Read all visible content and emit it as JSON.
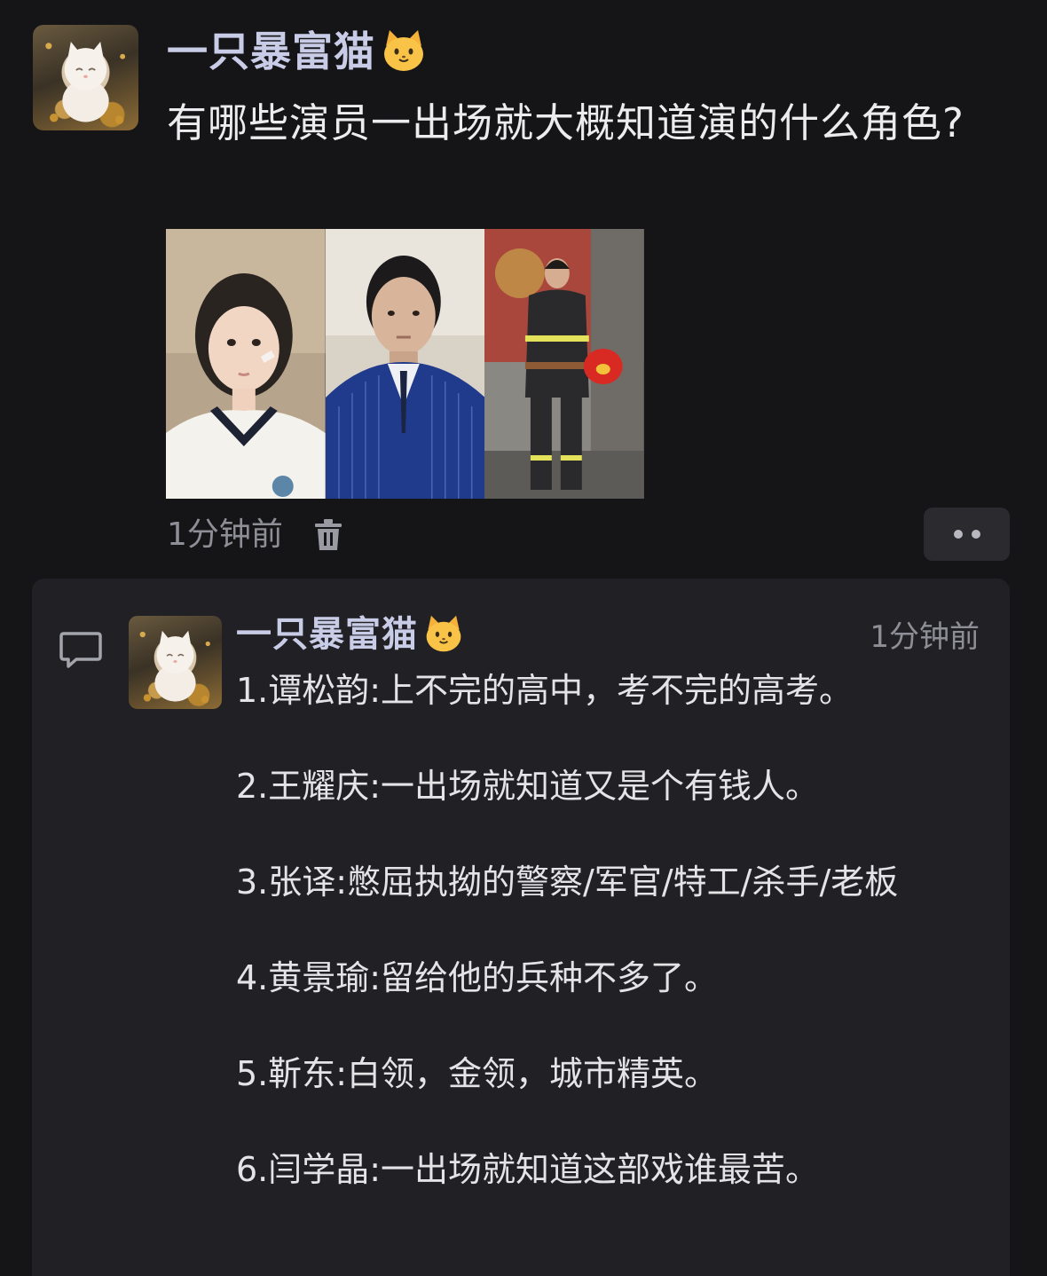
{
  "post": {
    "author": "一只暴富猫",
    "author_emoji": "cat-face-emoji",
    "question": "有哪些演员一出场就大概知道演的什么角色?",
    "time": "1分钟前",
    "photos": [
      {
        "name": "photo-girl-school-uniform"
      },
      {
        "name": "photo-man-pinstripe-suit"
      },
      {
        "name": "photo-firefighter"
      }
    ]
  },
  "comment": {
    "author": "一只暴富猫",
    "time": "1分钟前",
    "lines": [
      "1.谭松韵:上不完的高中，考不完的高考。",
      "2.王耀庆:一出场就知道又是个有钱人。",
      "3.张译:憋屈执拗的警察/军官/特工/杀手/老板",
      "4.黄景瑜:留给他的兵种不多了。",
      "5.靳东:白领，金领，城市精英。",
      "6.闫学晶:一出场就知道这部戏谁最苦。"
    ]
  },
  "colors": {
    "background": "#151518",
    "card": "#212125",
    "author": "#c9cce6",
    "muted": "#8e8e96"
  }
}
